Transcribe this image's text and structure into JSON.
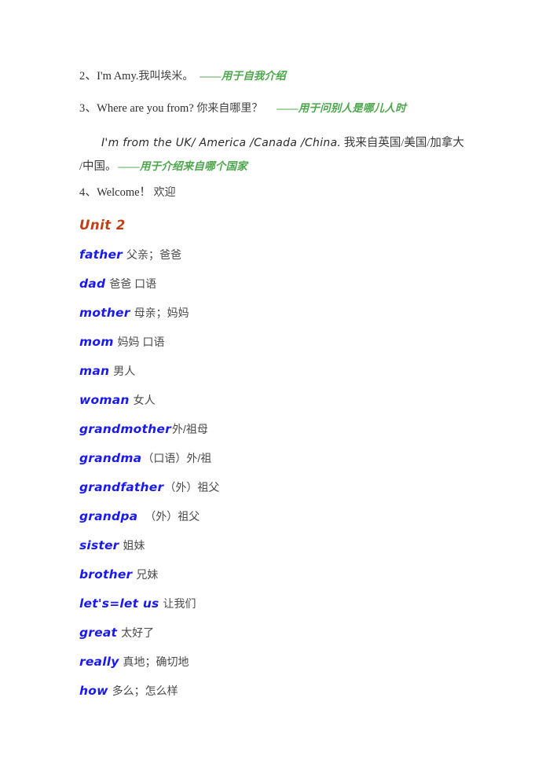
{
  "document": {
    "background_color": "#ffffff",
    "colors": {
      "word_blue": "#1a1aee",
      "heading_rust": "#bf4016",
      "note_green": "#4ca64c",
      "body_gray": "#4a4a4a"
    }
  },
  "phrases": [
    {
      "number": "2、",
      "english": "I'm Amy.",
      "chinese": "我叫埃米。",
      "note": "——用于自我介绍"
    },
    {
      "number": "3、",
      "english": "Where are you from?",
      "chinese": "你来自哪里？",
      "note": "——用于问别人是哪儿人时"
    }
  ],
  "example": {
    "line1_en": "I'm from the UK/ America /Canada /China.",
    "line1_cn": "我来自英国/美国/加拿大",
    "line2_cn": "/中国。",
    "line2_note": "——用于介绍来自哪个国家"
  },
  "phrase4": {
    "number": "4、",
    "english": "Welcome！",
    "chinese": "欢迎"
  },
  "unit": {
    "heading": "Unit 2"
  },
  "vocabulary": [
    {
      "word": "father",
      "meaning": "父亲；爸爸"
    },
    {
      "word": "dad",
      "meaning": "爸爸 口语"
    },
    {
      "word": "mother",
      "meaning": "母亲；妈妈"
    },
    {
      "word": "mom",
      "meaning": "妈妈 口语"
    },
    {
      "word": "man",
      "meaning": "男人"
    },
    {
      "word": "woman",
      "meaning": "女人"
    },
    {
      "word": "grandmother",
      "meaning": "外/祖母"
    },
    {
      "word": "grandma",
      "meaning": "（口语）外/祖"
    },
    {
      "word": "grandfather",
      "meaning": "（外）祖父"
    },
    {
      "word": "grandpa",
      "meaning": "（外）祖父"
    },
    {
      "word": "sister",
      "meaning": "姐妹"
    },
    {
      "word": "brother",
      "meaning": "兄妹"
    },
    {
      "word": "let's=let us",
      "meaning": "让我们"
    },
    {
      "word": "great",
      "meaning": "太好了"
    },
    {
      "word": "really",
      "meaning": "真地；确切地"
    },
    {
      "word": "how",
      "meaning": "多么；怎么样"
    }
  ]
}
